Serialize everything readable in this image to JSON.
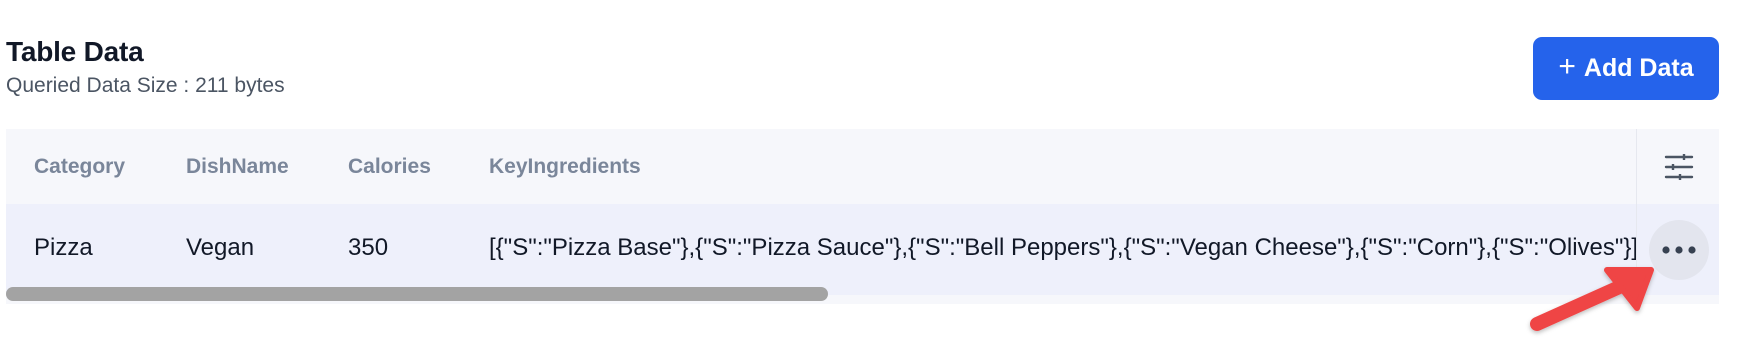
{
  "header": {
    "title": "Table Data",
    "subtitle": "Queried Data Size : 211 bytes",
    "add_button_plus": "+",
    "add_button_label": "Add Data"
  },
  "table": {
    "columns": [
      "Category",
      "DishName",
      "Calories",
      "KeyIngredients"
    ],
    "rows": [
      [
        "Pizza",
        "Vegan",
        "350",
        "[{\"S\":\"Pizza Base\"},{\"S\":\"Pizza Sauce\"},{\"S\":\"Bell Peppers\"},{\"S\":\"Vegan Cheese\"},{\"S\":\"Corn\"},{\"S\":\"Olives\"}]"
      ]
    ]
  },
  "icons": {
    "column_settings": "sliders-icon",
    "row_actions": "more-horizontal-icon",
    "annotation": "red-arrow-icon"
  },
  "colors": {
    "accent": "#2563eb",
    "annotation_arrow": "#ef4444"
  }
}
